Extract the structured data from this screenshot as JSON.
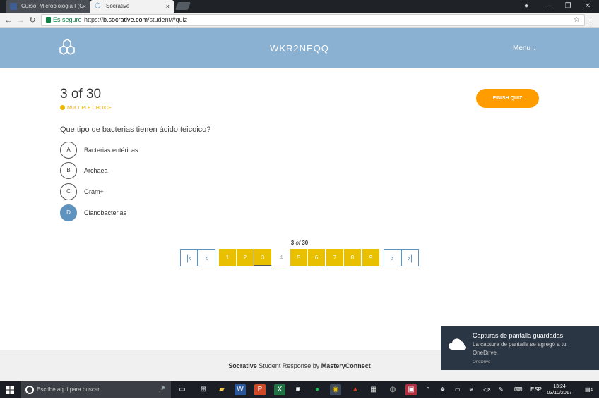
{
  "browser": {
    "tabs": [
      {
        "title": "Curso: Microbiologia I (C",
        "close": "×"
      },
      {
        "title": "Socrative",
        "close": "×"
      }
    ],
    "secure_label": "Es seguro",
    "url_scheme": "https://",
    "url_host": "b.socrative.com",
    "url_path": "/student/#quiz"
  },
  "header": {
    "room_name": "WKR2NEQQ",
    "menu_label": "Menu",
    "brand_color": "#8ab0d2"
  },
  "quiz": {
    "progress": "3 of 30",
    "question_type": "MULTIPLE CHOICE",
    "finish_label": "FINISH QUIZ",
    "question": "Que tipo de  bacterias tienen ácido teicoico?",
    "options": [
      {
        "letter": "A",
        "text": "Bacterias entéricas",
        "selected": false
      },
      {
        "letter": "B",
        "text": "Archaea",
        "selected": false
      },
      {
        "letter": "C",
        "text": "Gram+",
        "selected": false
      },
      {
        "letter": "D",
        "text": "Cianobacterias",
        "selected": true
      }
    ]
  },
  "pagination": {
    "current": "3",
    "of_word": "of",
    "total": "30",
    "pages": [
      "1",
      "2",
      "3",
      "4",
      "5",
      "6",
      "7",
      "8",
      "9"
    ]
  },
  "footer": {
    "brand": "Socrative",
    "middle": " Student Response by ",
    "company": "MasteryConnect"
  },
  "notification": {
    "title": "Capturas de pantalla guardadas",
    "body": "La captura de pantalla se agregó a tu OneDrive.",
    "source": "OneDrive"
  },
  "taskbar": {
    "search_placeholder": "Escribe aquí para buscar",
    "language": "ESP",
    "time": "13:24",
    "date": "03/10/2017",
    "notif_count": "4"
  }
}
